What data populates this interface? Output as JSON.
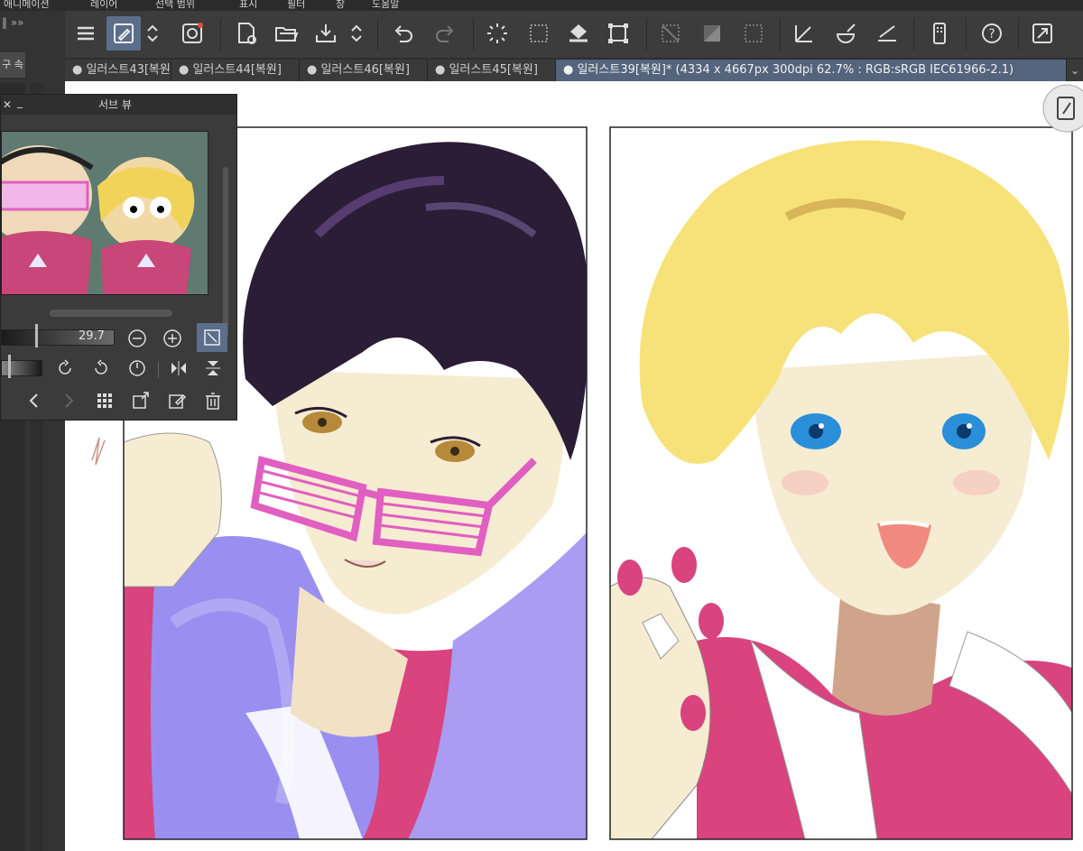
{
  "menu": {
    "items": [
      "애니메이션",
      "레이어",
      "선택 범위",
      "표시",
      "필터",
      "창",
      "도움말"
    ]
  },
  "left_panel": {
    "label": "구 속"
  },
  "tabs": [
    {
      "label": "● 일러스트43[복원]",
      "active": false
    },
    {
      "label": "● 일러스트44[복원]",
      "active": false
    },
    {
      "label": "● 일러스트46[복원]",
      "active": false
    },
    {
      "label": "● 일러스트45[복원]",
      "active": false
    },
    {
      "label": "● 일러스트39[복원]* (4334 x 4667px 300dpi 62.7% : RGB:sRGB IEC61966-2.1)",
      "active": true
    }
  ],
  "subview": {
    "title": "서브 뷰",
    "close": "✕",
    "minimize": "_",
    "zoom_value": "29.7"
  },
  "colors": {
    "accent": "#5b6e8a",
    "hair_dark": "#2a1d35",
    "hair_blonde": "#f7e27a",
    "shirt_pink": "#d9437e",
    "fur_purple": "#9a8ff0",
    "glasses_pink": "#e15fc0",
    "skin": "#f6ecd2"
  }
}
